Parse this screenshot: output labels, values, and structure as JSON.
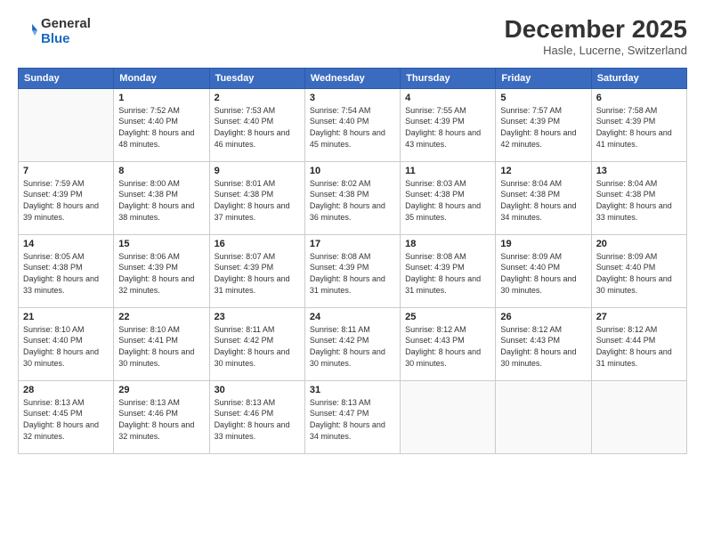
{
  "header": {
    "logo": {
      "line1": "General",
      "line2": "Blue"
    },
    "title": "December 2025",
    "location": "Hasle, Lucerne, Switzerland"
  },
  "weekdays": [
    "Sunday",
    "Monday",
    "Tuesday",
    "Wednesday",
    "Thursday",
    "Friday",
    "Saturday"
  ],
  "weeks": [
    [
      {
        "day": "",
        "empty": true
      },
      {
        "day": "1",
        "sunrise": "7:52 AM",
        "sunset": "4:40 PM",
        "daylight": "8 hours and 48 minutes."
      },
      {
        "day": "2",
        "sunrise": "7:53 AM",
        "sunset": "4:40 PM",
        "daylight": "8 hours and 46 minutes."
      },
      {
        "day": "3",
        "sunrise": "7:54 AM",
        "sunset": "4:40 PM",
        "daylight": "8 hours and 45 minutes."
      },
      {
        "day": "4",
        "sunrise": "7:55 AM",
        "sunset": "4:39 PM",
        "daylight": "8 hours and 43 minutes."
      },
      {
        "day": "5",
        "sunrise": "7:57 AM",
        "sunset": "4:39 PM",
        "daylight": "8 hours and 42 minutes."
      },
      {
        "day": "6",
        "sunrise": "7:58 AM",
        "sunset": "4:39 PM",
        "daylight": "8 hours and 41 minutes."
      }
    ],
    [
      {
        "day": "7",
        "sunrise": "7:59 AM",
        "sunset": "4:39 PM",
        "daylight": "8 hours and 39 minutes."
      },
      {
        "day": "8",
        "sunrise": "8:00 AM",
        "sunset": "4:38 PM",
        "daylight": "8 hours and 38 minutes."
      },
      {
        "day": "9",
        "sunrise": "8:01 AM",
        "sunset": "4:38 PM",
        "daylight": "8 hours and 37 minutes."
      },
      {
        "day": "10",
        "sunrise": "8:02 AM",
        "sunset": "4:38 PM",
        "daylight": "8 hours and 36 minutes."
      },
      {
        "day": "11",
        "sunrise": "8:03 AM",
        "sunset": "4:38 PM",
        "daylight": "8 hours and 35 minutes."
      },
      {
        "day": "12",
        "sunrise": "8:04 AM",
        "sunset": "4:38 PM",
        "daylight": "8 hours and 34 minutes."
      },
      {
        "day": "13",
        "sunrise": "8:04 AM",
        "sunset": "4:38 PM",
        "daylight": "8 hours and 33 minutes."
      }
    ],
    [
      {
        "day": "14",
        "sunrise": "8:05 AM",
        "sunset": "4:38 PM",
        "daylight": "8 hours and 33 minutes."
      },
      {
        "day": "15",
        "sunrise": "8:06 AM",
        "sunset": "4:39 PM",
        "daylight": "8 hours and 32 minutes."
      },
      {
        "day": "16",
        "sunrise": "8:07 AM",
        "sunset": "4:39 PM",
        "daylight": "8 hours and 31 minutes."
      },
      {
        "day": "17",
        "sunrise": "8:08 AM",
        "sunset": "4:39 PM",
        "daylight": "8 hours and 31 minutes."
      },
      {
        "day": "18",
        "sunrise": "8:08 AM",
        "sunset": "4:39 PM",
        "daylight": "8 hours and 31 minutes."
      },
      {
        "day": "19",
        "sunrise": "8:09 AM",
        "sunset": "4:40 PM",
        "daylight": "8 hours and 30 minutes."
      },
      {
        "day": "20",
        "sunrise": "8:09 AM",
        "sunset": "4:40 PM",
        "daylight": "8 hours and 30 minutes."
      }
    ],
    [
      {
        "day": "21",
        "sunrise": "8:10 AM",
        "sunset": "4:40 PM",
        "daylight": "8 hours and 30 minutes."
      },
      {
        "day": "22",
        "sunrise": "8:10 AM",
        "sunset": "4:41 PM",
        "daylight": "8 hours and 30 minutes."
      },
      {
        "day": "23",
        "sunrise": "8:11 AM",
        "sunset": "4:42 PM",
        "daylight": "8 hours and 30 minutes."
      },
      {
        "day": "24",
        "sunrise": "8:11 AM",
        "sunset": "4:42 PM",
        "daylight": "8 hours and 30 minutes."
      },
      {
        "day": "25",
        "sunrise": "8:12 AM",
        "sunset": "4:43 PM",
        "daylight": "8 hours and 30 minutes."
      },
      {
        "day": "26",
        "sunrise": "8:12 AM",
        "sunset": "4:43 PM",
        "daylight": "8 hours and 30 minutes."
      },
      {
        "day": "27",
        "sunrise": "8:12 AM",
        "sunset": "4:44 PM",
        "daylight": "8 hours and 31 minutes."
      }
    ],
    [
      {
        "day": "28",
        "sunrise": "8:13 AM",
        "sunset": "4:45 PM",
        "daylight": "8 hours and 32 minutes."
      },
      {
        "day": "29",
        "sunrise": "8:13 AM",
        "sunset": "4:46 PM",
        "daylight": "8 hours and 32 minutes."
      },
      {
        "day": "30",
        "sunrise": "8:13 AM",
        "sunset": "4:46 PM",
        "daylight": "8 hours and 33 minutes."
      },
      {
        "day": "31",
        "sunrise": "8:13 AM",
        "sunset": "4:47 PM",
        "daylight": "8 hours and 34 minutes."
      },
      {
        "day": "",
        "empty": true
      },
      {
        "day": "",
        "empty": true
      },
      {
        "day": "",
        "empty": true
      }
    ]
  ]
}
